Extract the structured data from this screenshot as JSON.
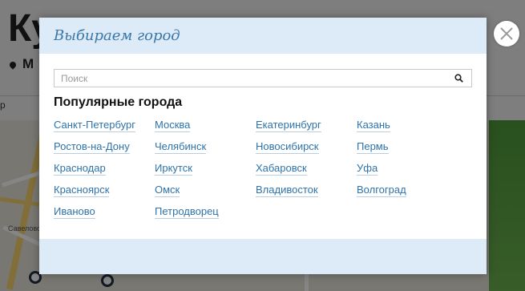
{
  "background": {
    "title": "Ку",
    "location_text": "М",
    "tab_text": "р",
    "map_label": "Савелово"
  },
  "modal": {
    "title": "Выбираем город",
    "search_placeholder": "Поиск",
    "search_value": "",
    "section_title": "Популярные города",
    "city_columns": [
      [
        "Санкт-Петербург",
        "Ростов-на-Дону",
        "Краснодар",
        "Красноярск",
        "Иваново"
      ],
      [
        "Москва",
        "Челябинск",
        "Иркутск",
        "Омск",
        "Петродворец"
      ],
      [
        "Екатеринбург",
        "Новосибирск",
        "Хабаровск",
        "Владивосток"
      ],
      [
        "Казань",
        "Пермь",
        "Уфа",
        "Волгоград"
      ]
    ]
  },
  "colors": {
    "header_bg": "#dcebf7",
    "title_color": "#3a78a8",
    "link_color": "#2f73a8"
  },
  "icons": {
    "close": "close-icon",
    "search": "search-icon",
    "location": "location-pin-icon"
  }
}
